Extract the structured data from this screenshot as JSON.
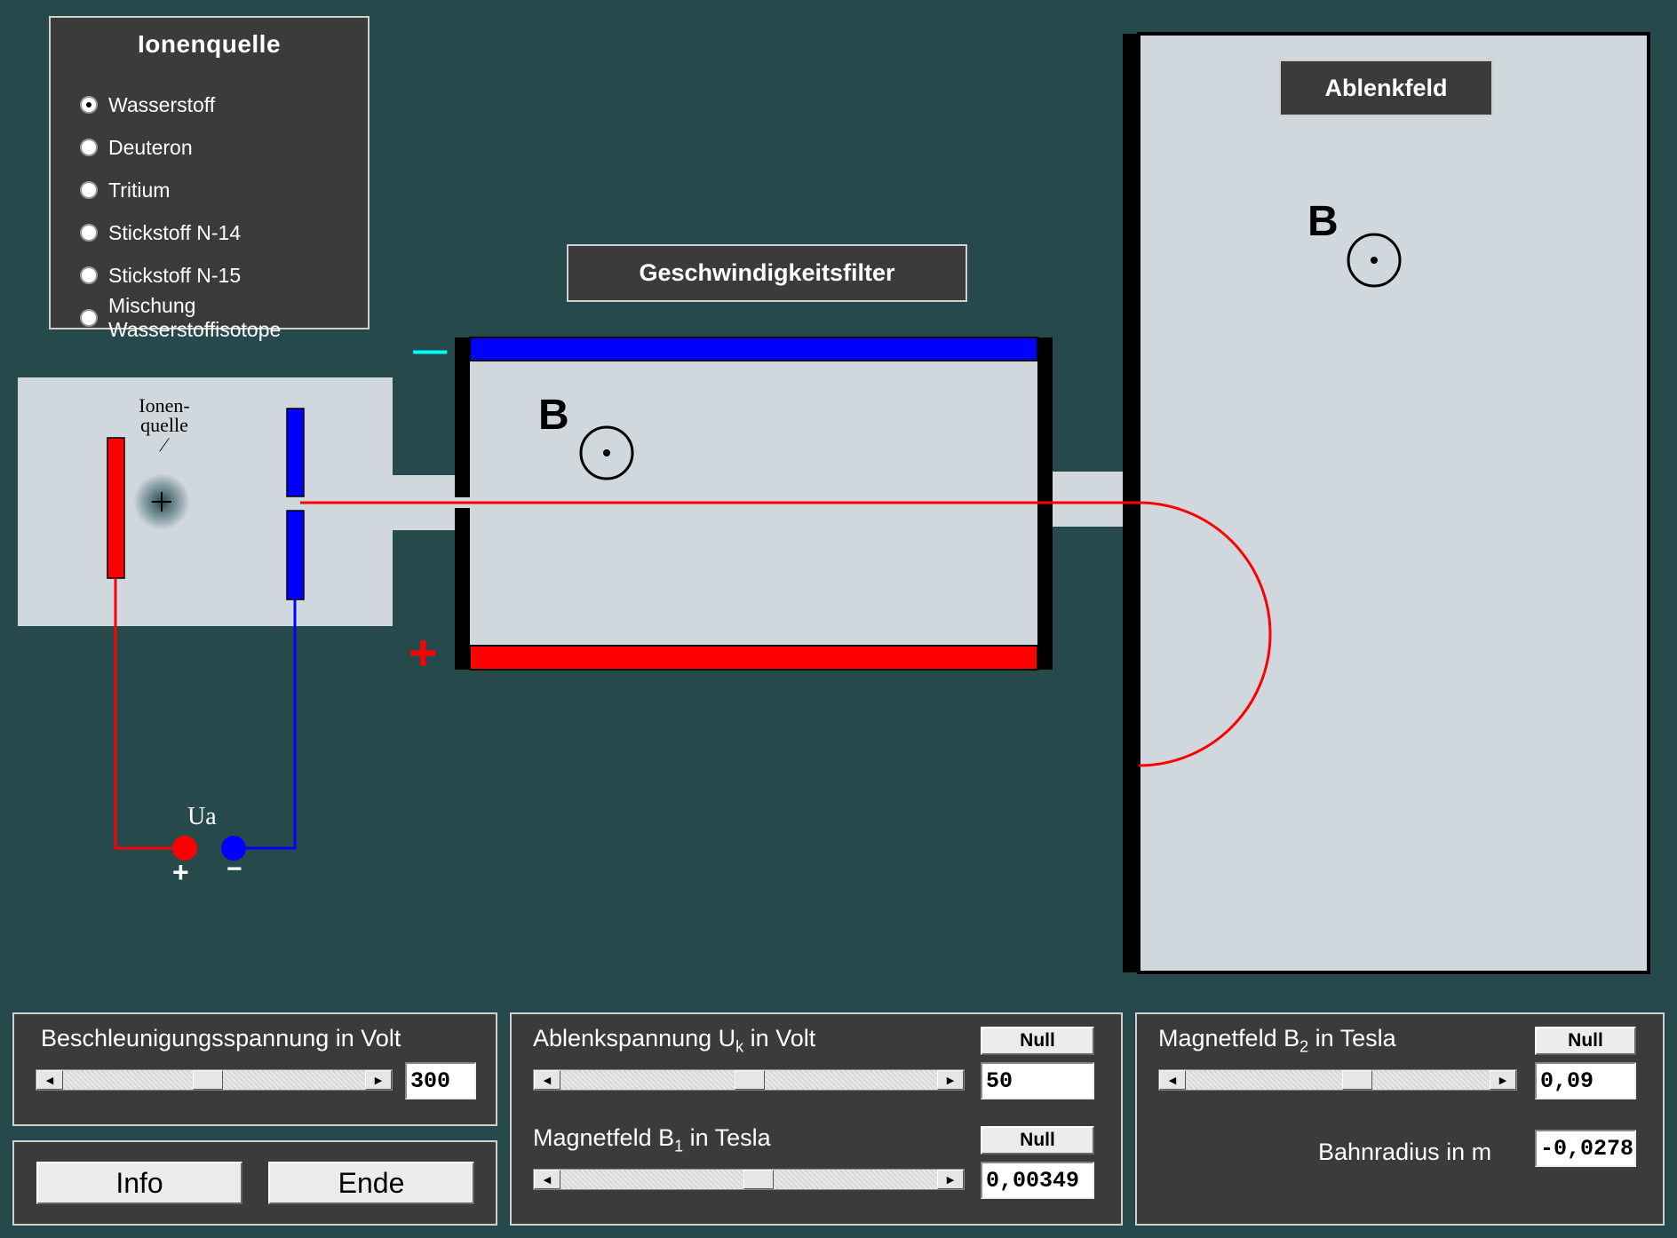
{
  "ion_source": {
    "title": "Ionenquelle",
    "options": [
      {
        "label": "Wasserstoff",
        "checked": true
      },
      {
        "label": "Deuteron",
        "checked": false
      },
      {
        "label": "Tritium",
        "checked": false
      },
      {
        "label": "Stickstoff N-14",
        "checked": false
      },
      {
        "label": "Stickstoff N-15",
        "checked": false
      },
      {
        "label": "Mischung Wasserstoffisotope",
        "checked": false
      }
    ]
  },
  "apparatus": {
    "source_label_line1": "Ionen-",
    "source_label_line2": "quelle",
    "source_slash": "/",
    "voltage_label": "Ua",
    "plus_terminal": "+",
    "minus_terminal": "−",
    "filter_title": "Geschwindigkeitsfilter",
    "filter_b_label": "B",
    "plate_minus_label": "––",
    "plate_plus_label": "+",
    "deflection_title": "Ablenkfeld",
    "deflection_b_label": "B"
  },
  "controls": {
    "acceleration": {
      "label": "Beschleunigungsspannung  in Volt",
      "value": "300",
      "slider_fraction": 0.5
    },
    "deflection_voltage": {
      "label_main": "Ablenkspannung U",
      "label_sub": "k",
      "label_tail": " in Volt",
      "null_label": "Null",
      "value": "50",
      "slider_fraction": 0.5
    },
    "magnetic_b1": {
      "label_main": "Magnetfeld B",
      "label_sub": "1",
      "label_tail": " in Tesla",
      "null_label": "Null",
      "value": "0,00349",
      "slider_fraction": 0.52
    },
    "magnetic_b2": {
      "label_main": "Magnetfeld B",
      "label_sub": "2",
      "label_tail": " in Tesla",
      "null_label": "Null",
      "value": "0,09",
      "slider_fraction": 0.55
    },
    "orbit_radius": {
      "label": "Bahnradius in m",
      "value": "-0,0278"
    },
    "info_button": "Info",
    "end_button": "Ende"
  },
  "colors": {
    "background": "#264a4c",
    "panel": "#3b3b3b",
    "chamber": "#d0d8de",
    "positive": "#ff0000",
    "negative": "#0000ff",
    "minus_plate_label": "#00ffff"
  }
}
